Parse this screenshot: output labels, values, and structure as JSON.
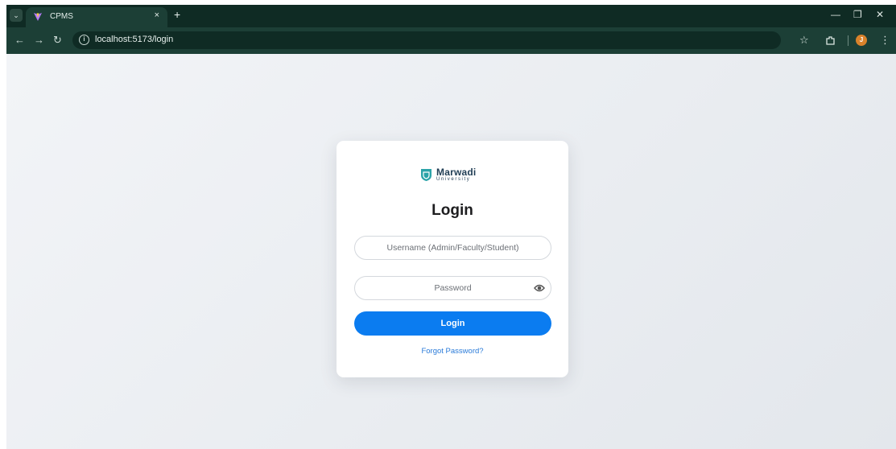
{
  "browser": {
    "tab_title": "CPMS",
    "tab_close": "×",
    "new_tab": "+",
    "url": "localhost:5173/login",
    "icons": [
      "tab-search-icon",
      "vite-favicon-icon",
      "back-icon",
      "forward-icon",
      "reload-icon",
      "site-info-icon",
      "bookmark-star-icon",
      "extensions-icon",
      "profile-avatar-icon",
      "menu-kebab-icon",
      "minimize-icon",
      "restore-icon",
      "close-icon"
    ],
    "profile_initial": "J",
    "window": {
      "minimize": "—",
      "restore": "❐",
      "close": "✕"
    },
    "nav": {
      "back": "←",
      "forward": "→",
      "reload": "↻"
    }
  },
  "login": {
    "logo_name": "Marwadi",
    "logo_sub": "University",
    "heading": "Login",
    "username_placeholder": "Username (Admin/Faculty/Student)",
    "password_placeholder": "Password",
    "submit_label": "Login",
    "forgot_label": "Forgot Password?"
  },
  "colors": {
    "browser_dark": "#0f2b24",
    "browser_toolbar": "#1c3f36",
    "page_bg": "#e8ebef",
    "button_blue": "#0b7cf0",
    "link_blue": "#2a7bd9",
    "logo_navy": "#1f3d54",
    "logo_teal": "#2ba3a8"
  }
}
